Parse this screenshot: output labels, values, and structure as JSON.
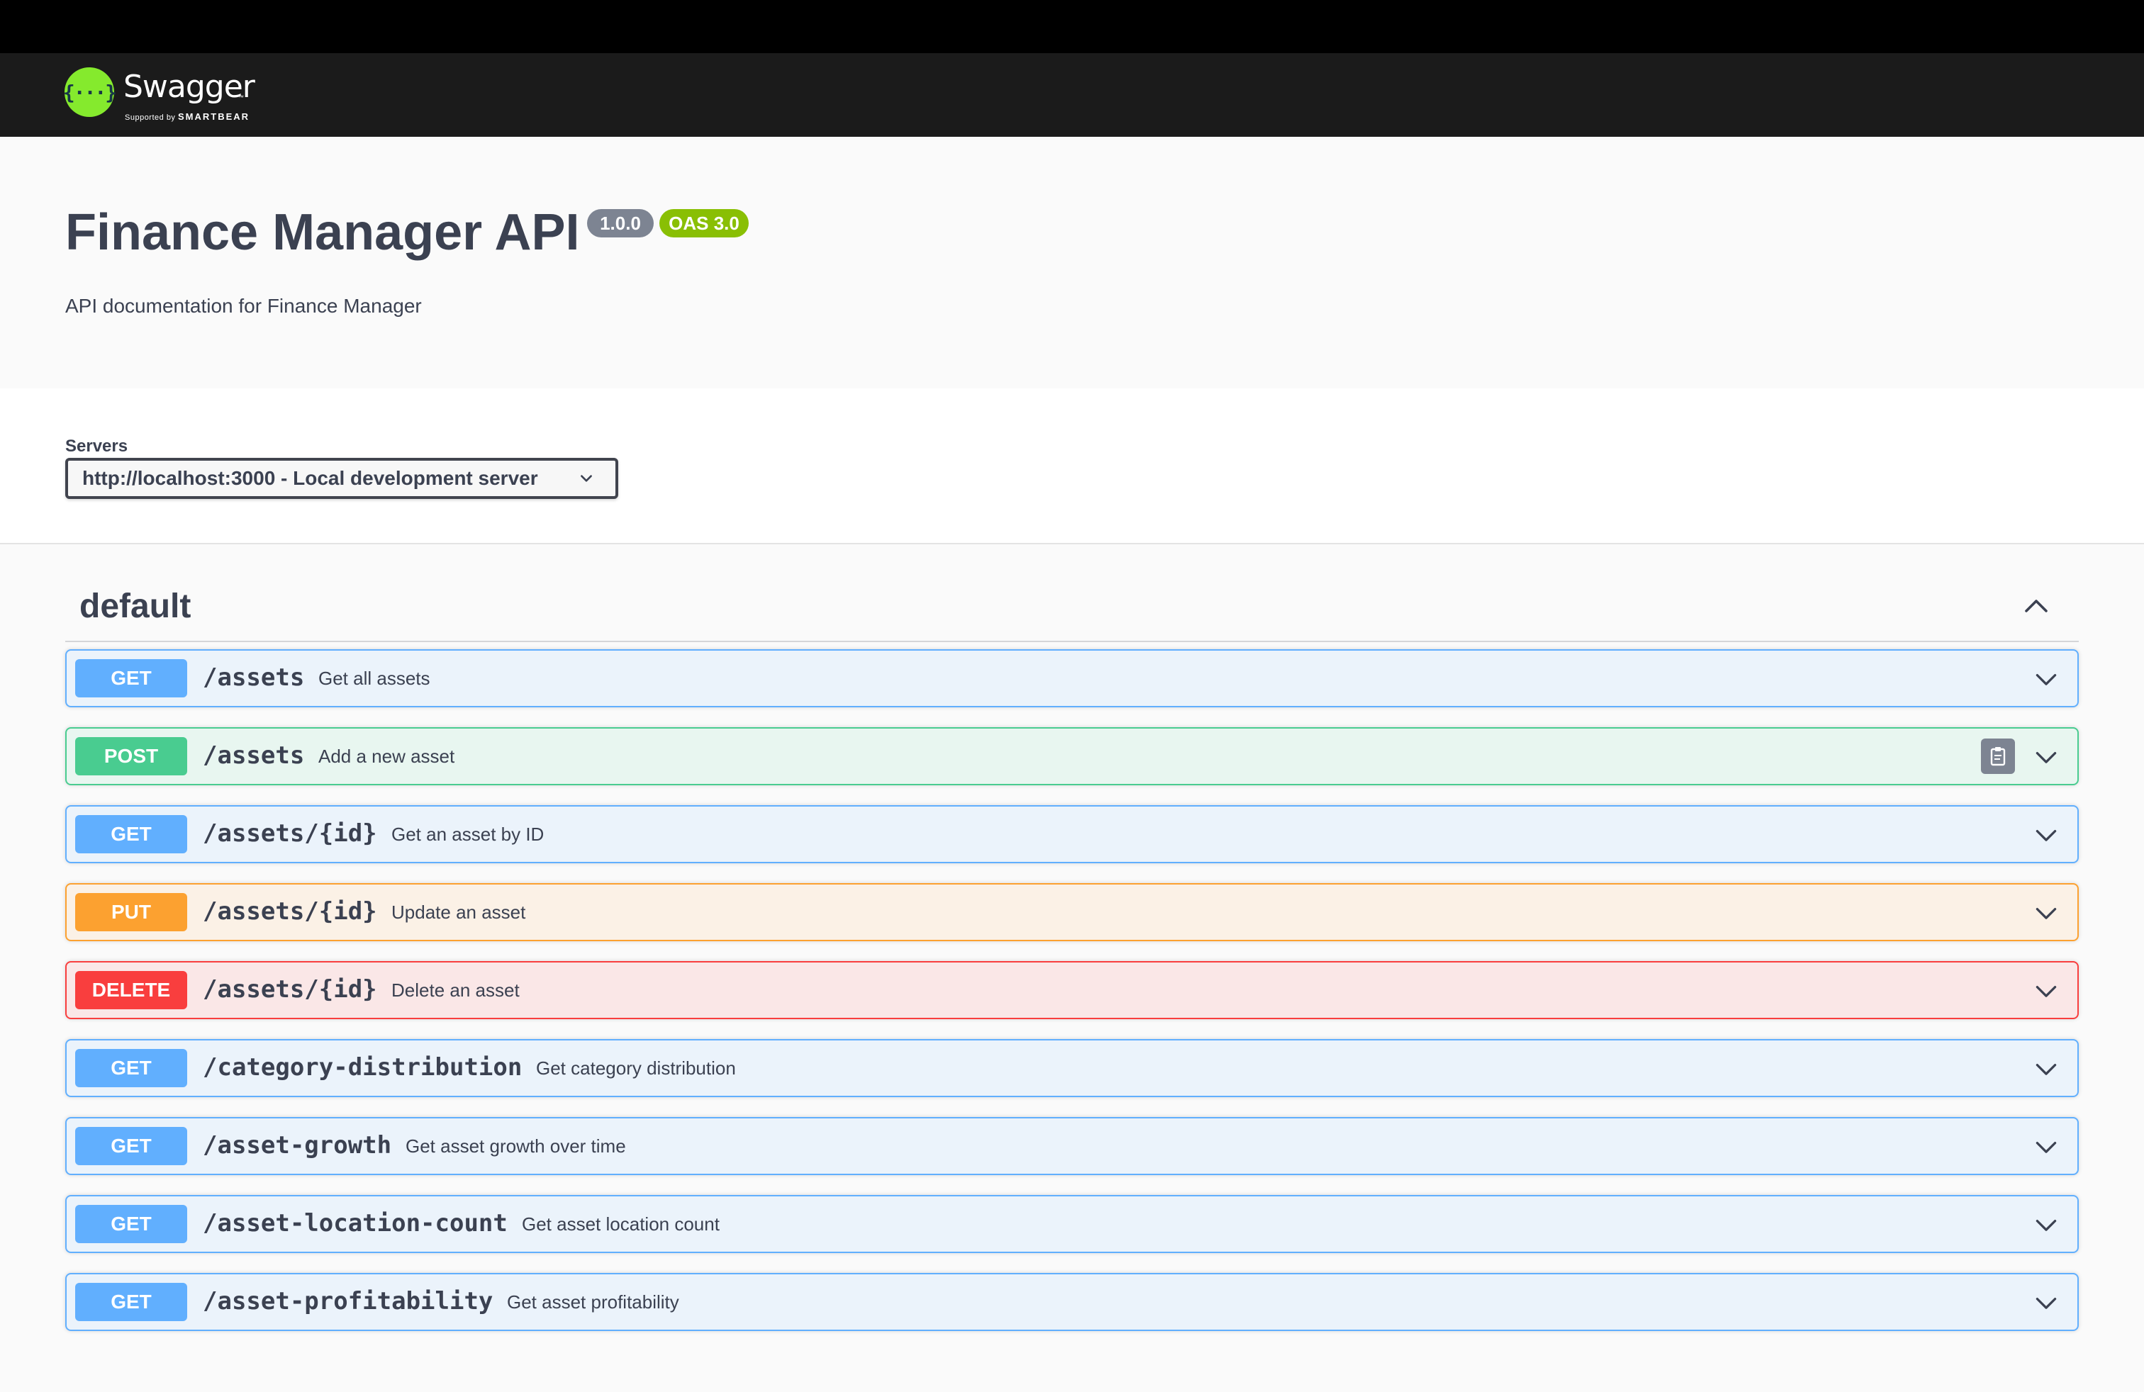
{
  "topbar": {
    "logo_symbol": "{···}",
    "logo_text": "Swagger",
    "logo_tm": "™",
    "supported_by": "Supported by",
    "smartbear": "SMARTBEAR"
  },
  "info": {
    "title": "Finance Manager API",
    "version": "1.0.0",
    "oas": "OAS 3.0",
    "description": "API documentation for Finance Manager"
  },
  "servers": {
    "label": "Servers",
    "selected": "http://localhost:3000 - Local development server"
  },
  "tag": {
    "name": "default",
    "expanded": true
  },
  "operations": [
    {
      "method": "GET",
      "path": "/assets",
      "summary": "Get all assets"
    },
    {
      "method": "POST",
      "path": "/assets",
      "summary": "Add a new asset",
      "has_copy": true
    },
    {
      "method": "GET",
      "path": "/assets/{id}",
      "summary": "Get an asset by ID"
    },
    {
      "method": "PUT",
      "path": "/assets/{id}",
      "summary": "Update an asset"
    },
    {
      "method": "DELETE",
      "path": "/assets/{id}",
      "summary": "Delete an asset"
    },
    {
      "method": "GET",
      "path": "/category-distribution",
      "summary": "Get category distribution"
    },
    {
      "method": "GET",
      "path": "/asset-growth",
      "summary": "Get asset growth over time"
    },
    {
      "method": "GET",
      "path": "/asset-location-count",
      "summary": "Get asset location count"
    },
    {
      "method": "GET",
      "path": "/asset-profitability",
      "summary": "Get asset profitability"
    }
  ],
  "colors": {
    "get": "#61affe",
    "post": "#49cc90",
    "put": "#fca130",
    "delete": "#f93e3e",
    "brand_green": "#85ea2d"
  }
}
